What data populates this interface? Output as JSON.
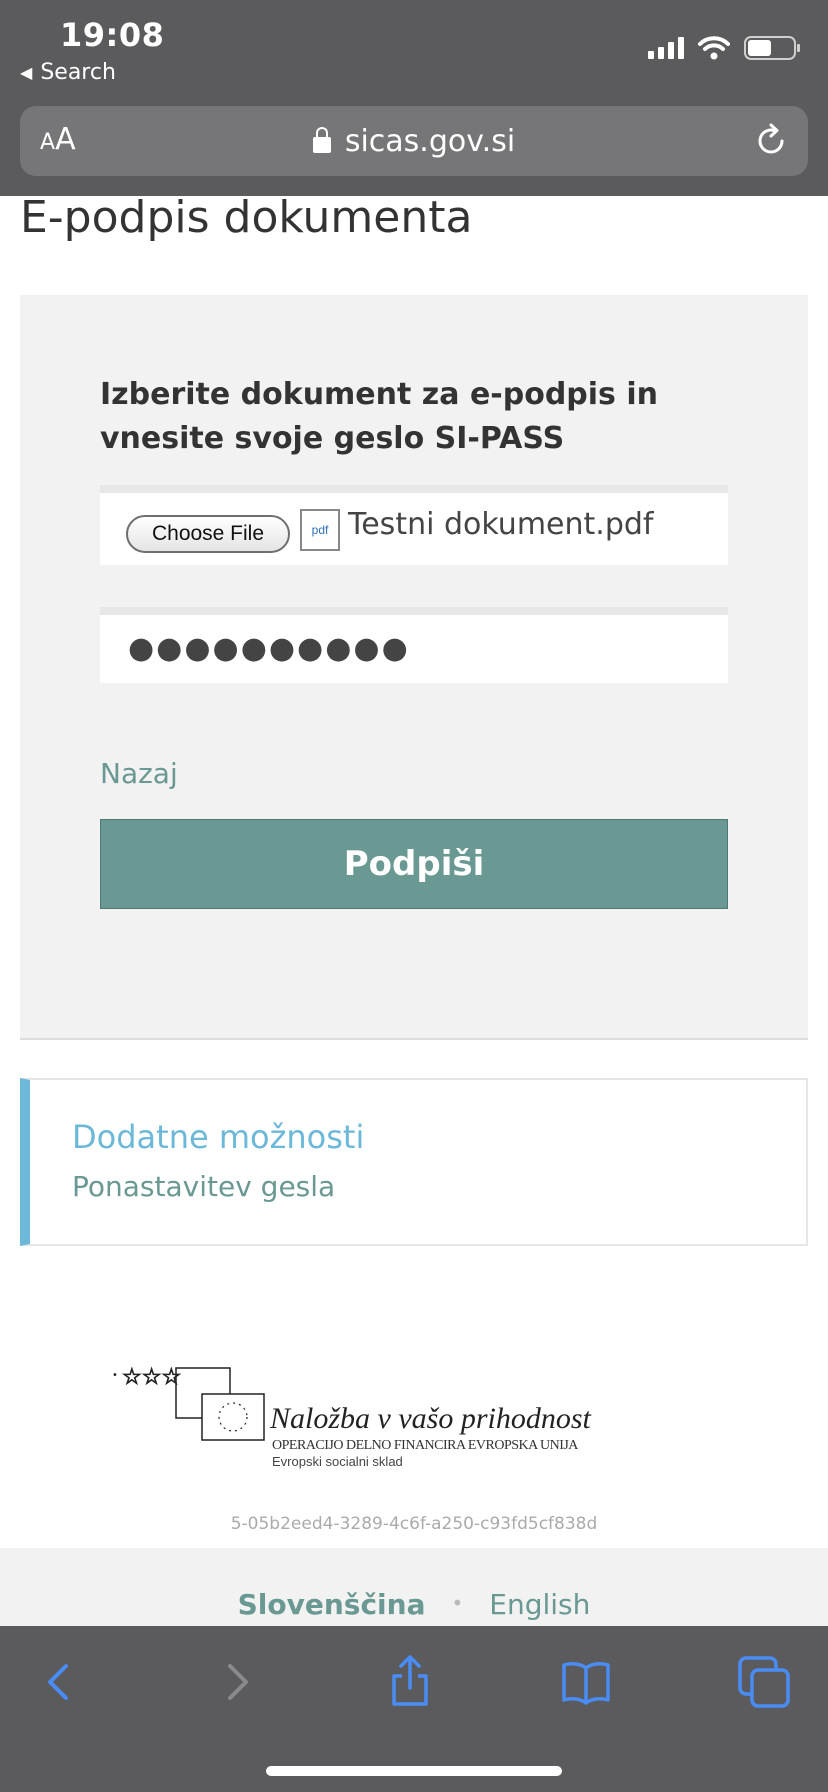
{
  "status_bar": {
    "time": "19:08",
    "back_label": "Search"
  },
  "address_bar": {
    "text_size_label_small": "A",
    "text_size_label_large": "A",
    "url": "sicas.gov.si"
  },
  "page": {
    "title": "E-podpis dokumenta",
    "instructions": "Izberite dokument za e-podpis in vnesite svoje geslo SI-PASS",
    "file_button_label": "Choose File",
    "file_icon_label": "pdf",
    "file_name": "Testni dokument.pdf",
    "password_value": "●●●●●●●●●●",
    "back_link": "Nazaj",
    "sign_button": "Podpiši"
  },
  "options": {
    "title": "Dodatne možnosti",
    "reset_link": "Ponastavitev gesla"
  },
  "logo": {
    "title": "Naložba v vašo prihodnost",
    "subtitle": "OPERACIJO DELNO FINANCIRA EVROPSKA UNIJA",
    "fund": "Evropski socialni sklad"
  },
  "session_id": "5-05b2eed4-3289-4c6f-a250-c93fd5cf838d",
  "footer": {
    "lang_slovenian": "Slovenščina",
    "lang_separator": "•",
    "lang_english": "English"
  },
  "colors": {
    "chrome": "#5b5b5d",
    "accent_green": "#6a9892",
    "accent_blue": "#6cb8d8",
    "toolbar_icon": "#4a8cf6"
  }
}
